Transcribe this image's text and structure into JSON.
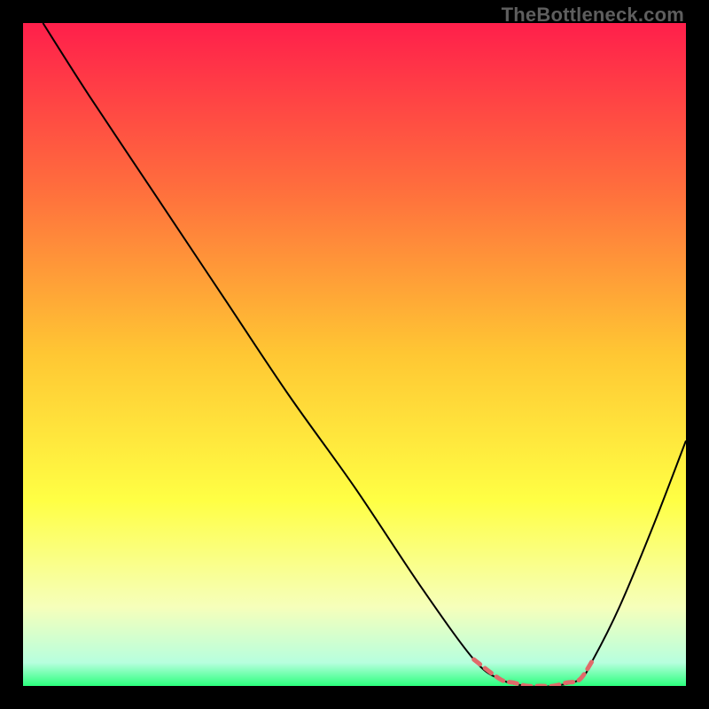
{
  "watermark": "TheBottleneck.com",
  "chart_data": {
    "type": "line",
    "title": "",
    "xlabel": "",
    "ylabel": "",
    "xlim": [
      0,
      100
    ],
    "ylim": [
      0,
      100
    ],
    "grid": false,
    "legend": false,
    "background_gradient_stops": [
      {
        "offset": 0,
        "color": "#ff1f4b"
      },
      {
        "offset": 0.25,
        "color": "#ff6e3d"
      },
      {
        "offset": 0.5,
        "color": "#ffc733"
      },
      {
        "offset": 0.72,
        "color": "#ffff44"
      },
      {
        "offset": 0.88,
        "color": "#f6ffba"
      },
      {
        "offset": 0.965,
        "color": "#b7ffde"
      },
      {
        "offset": 1.0,
        "color": "#2bff7d"
      }
    ],
    "series": [
      {
        "name": "bottleneck-curve",
        "color": "#000000",
        "stroke_width": 2,
        "x": [
          3,
          10,
          20,
          30,
          40,
          50,
          60,
          68,
          72,
          76,
          80,
          84,
          86,
          90,
          95,
          100
        ],
        "y": [
          100,
          89,
          74,
          59,
          44,
          30,
          15,
          4,
          1,
          0,
          0,
          1,
          4,
          12,
          24,
          37
        ]
      },
      {
        "name": "optimal-band-marker",
        "color": "#e06a6a",
        "stroke_width": 5,
        "style": "dashed",
        "x": [
          68,
          72,
          74,
          76,
          78,
          80,
          82,
          84,
          86
        ],
        "y": [
          4,
          1,
          0.5,
          0,
          0,
          0,
          0.5,
          1,
          4
        ]
      }
    ]
  }
}
